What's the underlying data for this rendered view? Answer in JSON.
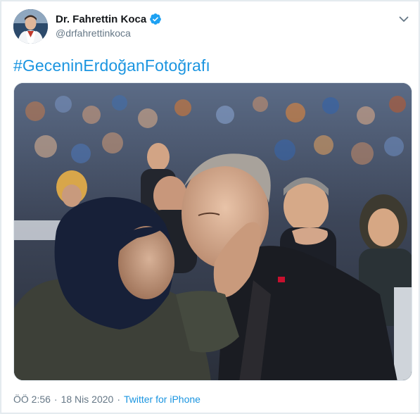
{
  "tweet": {
    "author": {
      "display_name": "Dr. Fahrettin Koca",
      "handle": "@drfahrettinkoca",
      "verified_icon": "verified-badge-icon"
    },
    "text": "#GeceninErdoğanFotoğrafı",
    "meta": {
      "time": "ÖÖ 2:56",
      "date": "18 Nis 2020",
      "separator": "·",
      "source": "Twitter for iPhone"
    }
  },
  "colors": {
    "link": "#1b95e0",
    "secondary_text": "#657786",
    "primary_text": "#14171a",
    "border": "#e1e8ed",
    "verified": "#1da1f2"
  }
}
